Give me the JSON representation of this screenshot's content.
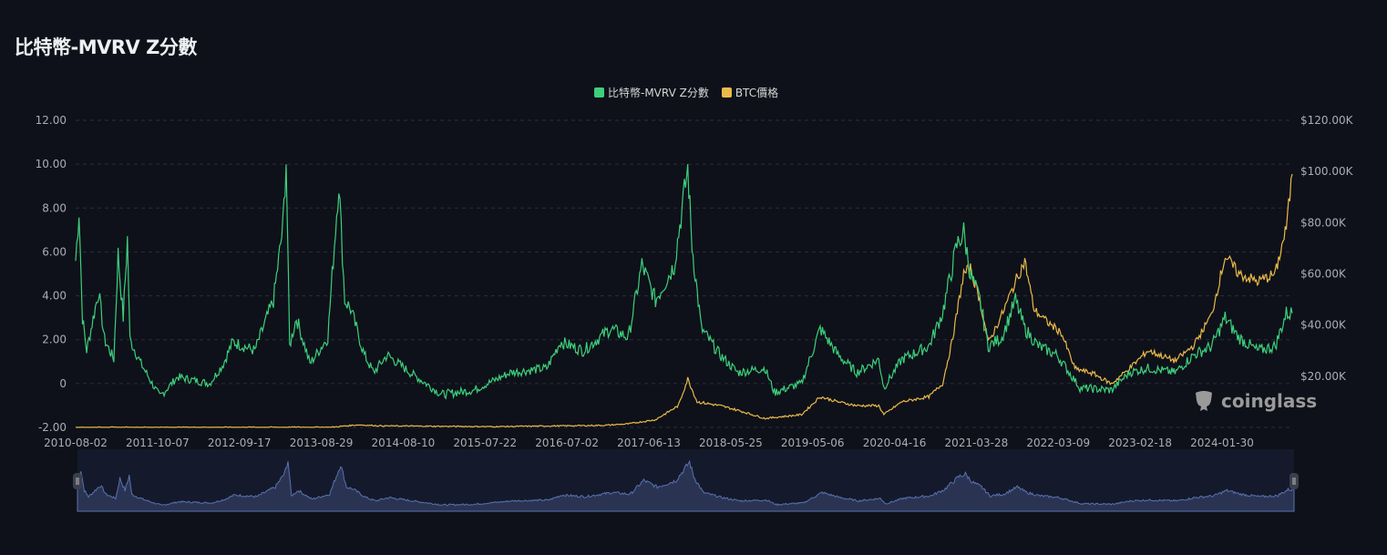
{
  "title": "比特幣-MVRV Z分數",
  "watermark": "coinglass",
  "chart_data": {
    "type": "line",
    "title": "比特幣-MVRV Z分數",
    "legend_position": "top-center",
    "grid": true,
    "x_tick_labels": [
      "2010-08-02",
      "2011-10-07",
      "2012-09-17",
      "2013-08-29",
      "2014-08-10",
      "2015-07-22",
      "2016-07-02",
      "2017-06-13",
      "2018-05-25",
      "2019-05-06",
      "2020-04-16",
      "2021-03-28",
      "2022-03-09",
      "2023-02-18",
      "2024-01-30"
    ],
    "x_range": [
      2010.58,
      2024.91
    ],
    "y_left": {
      "ticks": [
        "-2.00",
        "0",
        "2.00",
        "4.00",
        "6.00",
        "8.00",
        "10.00",
        "12.00"
      ],
      "range": [
        -2,
        12
      ]
    },
    "y_right": {
      "ticks": [
        "$20.00K",
        "$40.00K",
        "$60.00K",
        "$80.00K",
        "$100.00K",
        "$120.00K"
      ],
      "range_k": [
        0,
        120
      ]
    },
    "series": [
      {
        "name": "比特幣-MVRV Z分數",
        "color": "#3dcf7c",
        "axis": "left",
        "x_unit": "decimal year",
        "points": [
          [
            2010.58,
            5.6
          ],
          [
            2010.62,
            7.9
          ],
          [
            2010.66,
            3
          ],
          [
            2010.71,
            1.5
          ],
          [
            2010.85,
            4.2
          ],
          [
            2010.92,
            2
          ],
          [
            2011.03,
            1.1
          ],
          [
            2011.08,
            5.9
          ],
          [
            2011.14,
            3
          ],
          [
            2011.19,
            6.6
          ],
          [
            2011.22,
            2
          ],
          [
            2011.35,
            0.9
          ],
          [
            2011.57,
            -0.6
          ],
          [
            2011.78,
            0.3
          ],
          [
            2012.16,
            0
          ],
          [
            2012.32,
            0.9
          ],
          [
            2012.43,
            1.9
          ],
          [
            2012.69,
            1.5
          ],
          [
            2012.91,
            3.8
          ],
          [
            2013.02,
            7.1
          ],
          [
            2013.06,
            10.2
          ],
          [
            2013.1,
            1.7
          ],
          [
            2013.18,
            3
          ],
          [
            2013.34,
            0.9
          ],
          [
            2013.55,
            2.1
          ],
          [
            2013.68,
            9.2
          ],
          [
            2013.75,
            3.8
          ],
          [
            2013.82,
            3.4
          ],
          [
            2013.98,
            1.3
          ],
          [
            2014.09,
            0.5
          ],
          [
            2014.25,
            1.3
          ],
          [
            2014.52,
            0.5
          ],
          [
            2014.89,
            -0.5
          ],
          [
            2015.27,
            -0.3
          ],
          [
            2015.7,
            0.5
          ],
          [
            2016.13,
            0.7
          ],
          [
            2016.29,
            1.9
          ],
          [
            2016.56,
            1.5
          ],
          [
            2016.88,
            2.5
          ],
          [
            2017.09,
            2.1
          ],
          [
            2017.25,
            5.4
          ],
          [
            2017.41,
            3.8
          ],
          [
            2017.63,
            5.4
          ],
          [
            2017.79,
            9.8
          ],
          [
            2017.84,
            6.3
          ],
          [
            2017.95,
            2.5
          ],
          [
            2018.17,
            1.3
          ],
          [
            2018.38,
            0.5
          ],
          [
            2018.7,
            0.7
          ],
          [
            2018.81,
            -0.4
          ],
          [
            2019.13,
            0
          ],
          [
            2019.35,
            2.5
          ],
          [
            2019.56,
            1.3
          ],
          [
            2019.78,
            0.5
          ],
          [
            2020.04,
            1.1
          ],
          [
            2020.1,
            -0.2
          ],
          [
            2020.31,
            1.1
          ],
          [
            2020.63,
            1.7
          ],
          [
            2020.79,
            3.2
          ],
          [
            2020.96,
            6.3
          ],
          [
            2021.04,
            6.9
          ],
          [
            2021.12,
            5
          ],
          [
            2021.23,
            3.8
          ],
          [
            2021.33,
            1.7
          ],
          [
            2021.49,
            2.1
          ],
          [
            2021.65,
            3.8
          ],
          [
            2021.76,
            2.5
          ],
          [
            2021.92,
            1.7
          ],
          [
            2022.14,
            1.3
          ],
          [
            2022.41,
            -0.2
          ],
          [
            2022.78,
            -0.3
          ],
          [
            2022.99,
            0.5
          ],
          [
            2023.21,
            0.7
          ],
          [
            2023.53,
            0.5
          ],
          [
            2023.75,
            1.3
          ],
          [
            2023.96,
            1.7
          ],
          [
            2024.12,
            3
          ],
          [
            2024.28,
            2.1
          ],
          [
            2024.5,
            1.5
          ],
          [
            2024.71,
            1.7
          ],
          [
            2024.84,
            3.2
          ],
          [
            2024.91,
            3.2
          ]
        ]
      },
      {
        "name": "BTC價格",
        "color": "#e9b949",
        "axis": "right",
        "x_unit": "decimal year",
        "y_unit": "thousand USD",
        "points": [
          [
            2010.58,
            0
          ],
          [
            2013.6,
            0.1
          ],
          [
            2013.9,
            1
          ],
          [
            2014.2,
            0.6
          ],
          [
            2015.5,
            0.3
          ],
          [
            2016.8,
            0.8
          ],
          [
            2017.09,
            1.4
          ],
          [
            2017.41,
            3
          ],
          [
            2017.68,
            8.5
          ],
          [
            2017.79,
            19
          ],
          [
            2017.9,
            10
          ],
          [
            2018.17,
            8.5
          ],
          [
            2018.38,
            6.7
          ],
          [
            2018.7,
            3.5
          ],
          [
            2019.13,
            5
          ],
          [
            2019.35,
            12
          ],
          [
            2019.56,
            10
          ],
          [
            2019.78,
            8.5
          ],
          [
            2020.04,
            8.5
          ],
          [
            2020.1,
            5
          ],
          [
            2020.31,
            10
          ],
          [
            2020.63,
            12
          ],
          [
            2020.79,
            17
          ],
          [
            2020.9,
            33
          ],
          [
            2021.04,
            60
          ],
          [
            2021.12,
            62
          ],
          [
            2021.23,
            50
          ],
          [
            2021.33,
            33
          ],
          [
            2021.49,
            44
          ],
          [
            2021.65,
            57
          ],
          [
            2021.76,
            65
          ],
          [
            2021.87,
            46
          ],
          [
            2022.03,
            41
          ],
          [
            2022.19,
            37
          ],
          [
            2022.35,
            23
          ],
          [
            2022.57,
            21
          ],
          [
            2022.78,
            17
          ],
          [
            2022.99,
            23
          ],
          [
            2023.21,
            30
          ],
          [
            2023.53,
            26
          ],
          [
            2023.75,
            32
          ],
          [
            2023.96,
            44
          ],
          [
            2024.12,
            67
          ],
          [
            2024.28,
            60
          ],
          [
            2024.5,
            57
          ],
          [
            2024.71,
            60
          ],
          [
            2024.84,
            78
          ],
          [
            2024.91,
            99
          ]
        ]
      }
    ]
  }
}
